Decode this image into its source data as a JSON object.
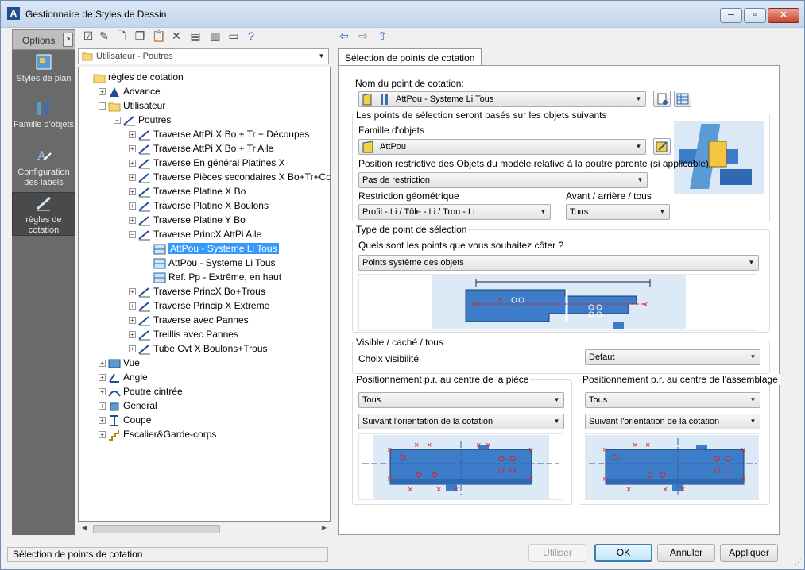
{
  "window": {
    "title": "Gestionnaire de Styles de Dessin",
    "buttons": {
      "minimize": "─",
      "maximize": "▫",
      "close": "✕"
    }
  },
  "options": {
    "label": "Options",
    "arrow": ">"
  },
  "left_nav": [
    {
      "label": "Styles de plan",
      "icon": "styles-de-plan-icon"
    },
    {
      "label": "Famille d'objets",
      "icon": "famille-objets-icon"
    },
    {
      "label": "Configuration des labels",
      "icon": "configuration-labels-icon"
    },
    {
      "label": "règles de cotation",
      "icon": "regles-cotation-icon",
      "selected": true
    }
  ],
  "toolbar": [
    "checkbox-icon",
    "edit-icon",
    "new-icon",
    "copy-icon",
    "paste-icon",
    "delete-icon",
    "import-icon",
    "export-icon",
    "dimension-icon",
    "help-icon"
  ],
  "nav": {
    "back": "⇦",
    "forward": "⇨",
    "up": "⇧"
  },
  "tree_combo": {
    "value": "Utilisateur - Poutres"
  },
  "tree": [
    {
      "label": "règles de cotation",
      "level": 0,
      "expander": "",
      "icon": "folder-icon"
    },
    {
      "label": "Advance",
      "level": 1,
      "expander": "+",
      "icon": "advance-icon"
    },
    {
      "label": "Utilisateur",
      "level": 1,
      "expander": "−",
      "icon": "folder-icon"
    },
    {
      "label": "Poutres",
      "level": 2,
      "expander": "−",
      "icon": "beam-icon"
    },
    {
      "label": "Traverse AttPi X Bo + Tr + Découpes",
      "level": 3,
      "expander": "+",
      "icon": "beam-icon"
    },
    {
      "label": "Traverse AttPi X Bo + Tr Aile",
      "level": 3,
      "expander": "+",
      "icon": "beam-icon"
    },
    {
      "label": "Traverse En général Platines X",
      "level": 3,
      "expander": "+",
      "icon": "beam-icon"
    },
    {
      "label": "Traverse Pièces secondaires X Bo+Tr+Conto",
      "level": 3,
      "expander": "+",
      "icon": "beam-icon"
    },
    {
      "label": "Traverse Platine X Bo",
      "level": 3,
      "expander": "+",
      "icon": "beam-icon"
    },
    {
      "label": "Traverse Platine X Boulons",
      "level": 3,
      "expander": "+",
      "icon": "beam-icon"
    },
    {
      "label": "Traverse Platine Y Bo",
      "level": 3,
      "expander": "+",
      "icon": "beam-icon"
    },
    {
      "label": "Traverse PrincX AttPi Aile",
      "level": 3,
      "expander": "−",
      "icon": "beam-icon"
    },
    {
      "label": "AttPou - Systeme Li Tous",
      "level": 4,
      "expander": "",
      "icon": "dim-point-icon",
      "selected": true
    },
    {
      "label": "AttPou - Systeme Li Tous",
      "level": 4,
      "expander": "",
      "icon": "dim-point-icon"
    },
    {
      "label": "Ref. Pp - Extrême, en haut",
      "level": 4,
      "expander": "",
      "icon": "dim-point-icon"
    },
    {
      "label": "Traverse PrincX Bo+Trous",
      "level": 3,
      "expander": "+",
      "icon": "beam-icon"
    },
    {
      "label": "Traverse Princip X Extreme",
      "level": 3,
      "expander": "+",
      "icon": "beam-icon"
    },
    {
      "label": "Traverse avec Pannes",
      "level": 3,
      "expander": "+",
      "icon": "beam-icon"
    },
    {
      "label": "Treillis avec Pannes",
      "level": 3,
      "expander": "+",
      "icon": "beam-icon"
    },
    {
      "label": "Tube Cvt X Boulons+Trous",
      "level": 3,
      "expander": "+",
      "icon": "beam-icon"
    },
    {
      "label": "Vue",
      "level": 1,
      "expander": "+",
      "icon": "view-icon"
    },
    {
      "label": "Angle",
      "level": 1,
      "expander": "+",
      "icon": "angle-icon"
    },
    {
      "label": "Poutre cintrée",
      "level": 1,
      "expander": "+",
      "icon": "curved-beam-icon"
    },
    {
      "label": "General",
      "level": 1,
      "expander": "+",
      "icon": "general-icon"
    },
    {
      "label": "Coupe",
      "level": 1,
      "expander": "+",
      "icon": "section-icon"
    },
    {
      "label": "Escalier&Garde-corps",
      "level": 1,
      "expander": "+",
      "icon": "stairs-icon"
    }
  ],
  "tab": {
    "label": "Sélection de points de cotation"
  },
  "form": {
    "name_label": "Nom du point de cotation:",
    "name_value": "AttPou - Systeme Li Tous",
    "based_label": "Les points de sélection seront basés sur les objets suivants",
    "famille_label": "Famille d'objets",
    "famille_value": "AttPou",
    "position_label": "Position restrictive des Objets du modèle relative à la poutre parente (si applicable)",
    "position_value": "Pas de restriction",
    "restriction_label": "Restriction géométrique",
    "restriction_value": "Profil - Li / Tôle - Li / Trou - Li",
    "avant_label": "Avant / arrière / tous",
    "avant_value": "Tous",
    "type_title": "Type de point de sélection",
    "question_label": "Quels sont les points que vous souhaitez côter ?",
    "points_value": "Points système des objets",
    "visible_title": "Visible / caché / tous",
    "choix_label": "Choix visibilité",
    "choix_value": "Defaut",
    "piece_title": "Positionnement p.r. au centre de la pièce",
    "piece_value1": "Tous",
    "piece_value2": "Suivant l'orientation de la cotation",
    "assemblage_title": "Positionnement p.r. au centre de l'assemblage",
    "assemblage_value1": "Tous",
    "assemblage_value2": "Suivant l'orientation de la cotation"
  },
  "status": "Sélection de points de cotation",
  "buttons": {
    "utiliser": "Utiliser",
    "ok": "OK",
    "annuler": "Annuler",
    "appliquer": "Appliquer"
  },
  "colors": {
    "accent": "#3399ff",
    "beam": "#5b9bd5",
    "marker": "#e02020"
  }
}
